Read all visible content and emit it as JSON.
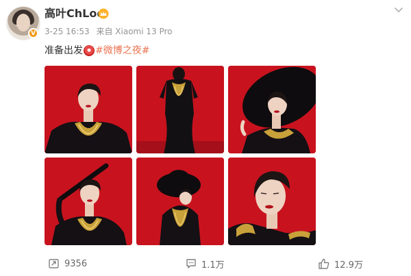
{
  "header": {
    "username": "高叶ChLoe",
    "verified_badge": "V",
    "timestamp": "3-25 16:53",
    "source": "来自 Xiaomi 13 Pro"
  },
  "post": {
    "text_prefix": "准备出发",
    "emoji": "target-emoji",
    "topic": "#微博之夜#"
  },
  "images": [
    {
      "name": "photo-1"
    },
    {
      "name": "photo-2"
    },
    {
      "name": "photo-3"
    },
    {
      "name": "photo-4"
    },
    {
      "name": "photo-5"
    },
    {
      "name": "photo-6"
    }
  ],
  "footer": {
    "repost_count": "9356",
    "comment_count": "1.1万",
    "like_count": "12.9万"
  },
  "colors": {
    "accent": "#eb7350",
    "photo_background": "#c8131f",
    "gold": "#c9a13a"
  }
}
